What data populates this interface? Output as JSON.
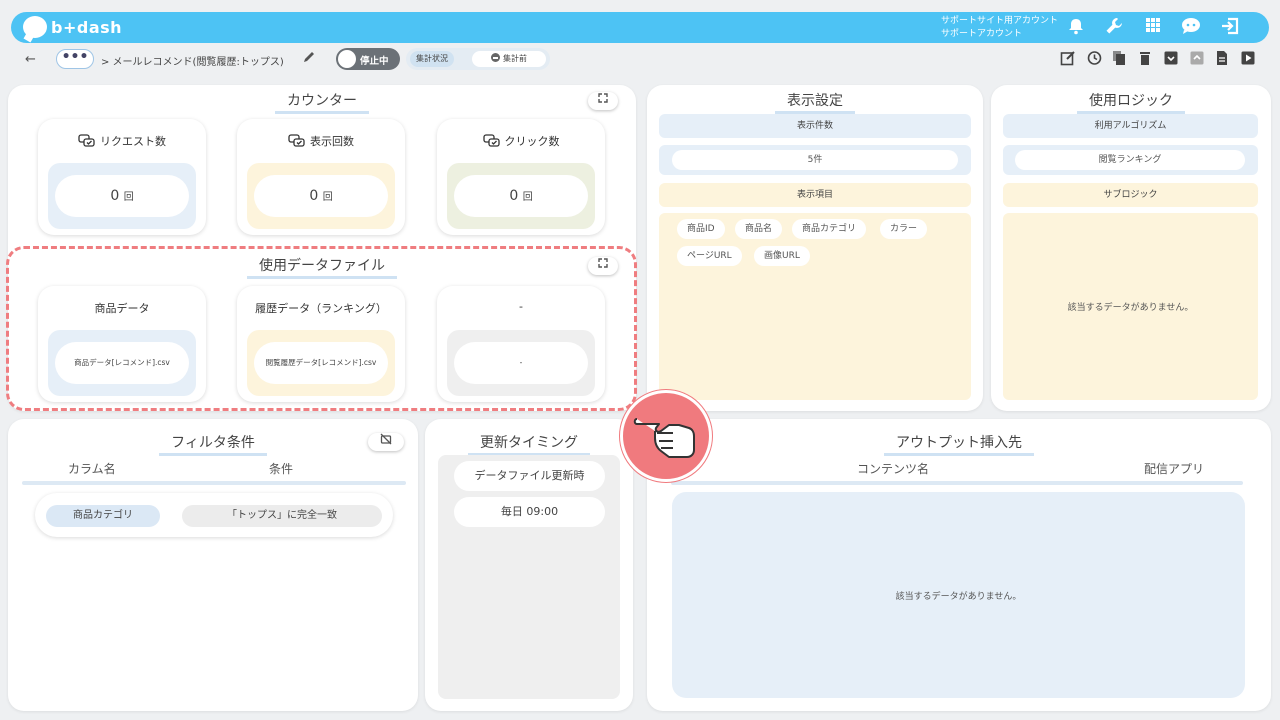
{
  "header": {
    "logo_text": "b+dash",
    "account_line1": "サポートサイト用アカウント",
    "account_line2": "サポートアカウント",
    "icons": [
      "bell-icon",
      "wrench-icon",
      "grid-icon",
      "chat-icon",
      "logout-icon"
    ]
  },
  "subbar": {
    "back_icon": "←",
    "more_label": "•••",
    "breadcrumb": "> メールレコメンド(閲覧履歴:トップス)",
    "toggle_label": "停止中",
    "stat_label": "集計状況",
    "stat_value": "集計前",
    "tool_icons": [
      "edit-icon",
      "history-icon",
      "copy-icon",
      "trash-icon",
      "archive-icon",
      "unarchive-icon",
      "document-icon",
      "play-icon"
    ]
  },
  "counter": {
    "title": "カウンター",
    "cards": [
      {
        "label": "リクエスト数",
        "value": "0",
        "unit": "回",
        "color": "#e6eff8"
      },
      {
        "label": "表示回数",
        "value": "0",
        "unit": "回",
        "color": "#fdf4dc"
      },
      {
        "label": "クリック数",
        "value": "0",
        "unit": "回",
        "color": "#edf0e0"
      }
    ]
  },
  "files": {
    "title": "使用データファイル",
    "cards": [
      {
        "label": "商品データ",
        "value": "商品データ[レコメンド].csv"
      },
      {
        "label": "履歴データ（ランキング）",
        "value": "閲覧履歴データ[レコメンド].csv"
      },
      {
        "label": "-",
        "value": "-"
      }
    ]
  },
  "display": {
    "title": "表示設定",
    "count_header": "表示件数",
    "count_value": "5件",
    "items_header": "表示項目",
    "items": [
      "商品ID",
      "商品名",
      "商品カテゴリ",
      "カラー",
      "ページURL",
      "画像URL"
    ]
  },
  "logic": {
    "title": "使用ロジック",
    "algo_header": "利用アルゴリズム",
    "algo_value": "閲覧ランキング",
    "sub_header": "サブロジック",
    "sub_empty": "該当するデータがありません。"
  },
  "filter": {
    "title": "フィルタ条件",
    "col_header": "カラム名",
    "cond_header": "条件",
    "row_column": "商品カテゴリ",
    "row_condition": "「トップス」に完全一致"
  },
  "timing": {
    "title": "更新タイミング",
    "trigger": "データファイル更新時",
    "schedule": "毎日 09:00"
  },
  "output": {
    "title": "アウトプット挿入先",
    "col_content": "コンテンツ名",
    "col_app": "配信アプリ",
    "empty": "該当するデータがありません。"
  }
}
